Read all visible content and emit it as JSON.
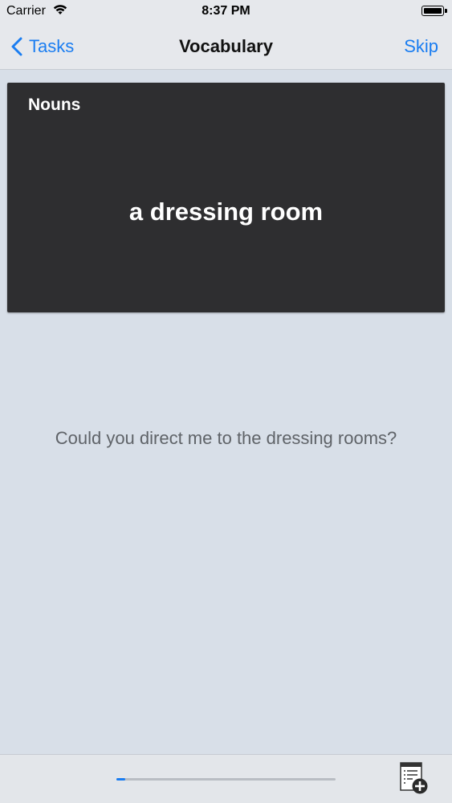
{
  "status_bar": {
    "carrier": "Carrier",
    "time": "8:37 PM",
    "wifi_icon": "wifi-icon",
    "battery_icon": "battery-icon"
  },
  "nav": {
    "back_label": "Tasks",
    "title": "Vocabulary",
    "skip_label": "Skip"
  },
  "card": {
    "category": "Nouns",
    "term": "a dressing room"
  },
  "example_sentence": "Could you direct me to the dressing rooms?",
  "bottom_bar": {
    "progress_fraction": 0.04,
    "add_icon": "add-to-list-icon"
  },
  "colors": {
    "accent": "#1a7df1",
    "card_background": "#2e2e30",
    "page_background": "#d8dfe8"
  }
}
